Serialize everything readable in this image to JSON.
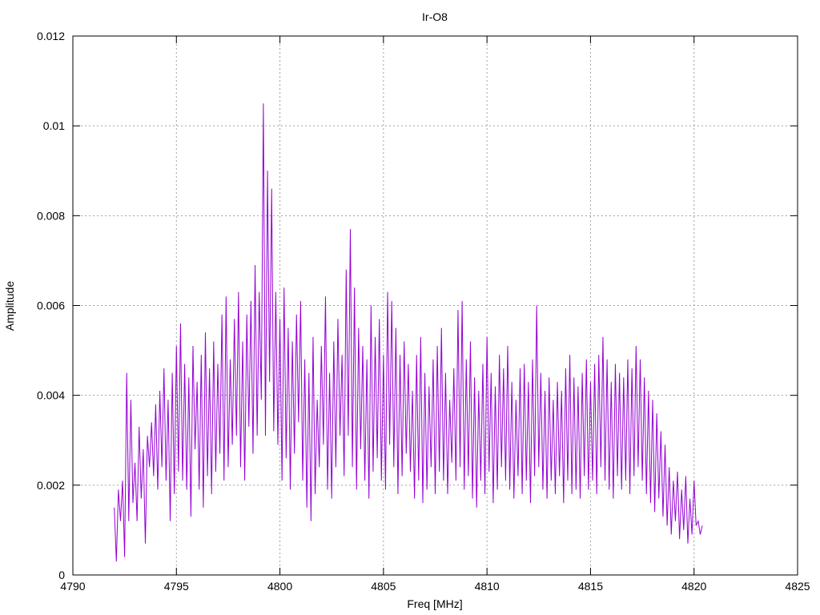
{
  "chart_data": {
    "type": "line",
    "title": "Ir-O8",
    "xlabel": "Freq [MHz]",
    "ylabel": "Amplitude",
    "xlim": [
      4790,
      4825
    ],
    "ylim": [
      0,
      0.012
    ],
    "x_ticks": [
      "4790",
      "4795",
      "4800",
      "4805",
      "4810",
      "4815",
      "4820",
      "4825"
    ],
    "y_ticks": [
      "0",
      "0.002",
      "0.004",
      "0.006",
      "0.008",
      "0.01",
      "0.012"
    ],
    "grid": true,
    "series_color": "#9400d3",
    "series": [
      {
        "x_start": 4792.0,
        "x_step": 0.1,
        "values": [
          0.0015,
          0.0003,
          0.0019,
          0.0012,
          0.0021,
          0.0004,
          0.0045,
          0.0012,
          0.0039,
          0.0016,
          0.0025,
          0.0012,
          0.0033,
          0.0017,
          0.0028,
          0.0007,
          0.0031,
          0.0024,
          0.0034,
          0.0022,
          0.0038,
          0.0019,
          0.0041,
          0.0024,
          0.0046,
          0.0021,
          0.0039,
          0.0012,
          0.0045,
          0.0018,
          0.0051,
          0.0023,
          0.0056,
          0.0021,
          0.0047,
          0.0019,
          0.0044,
          0.0013,
          0.0051,
          0.0028,
          0.0043,
          0.0019,
          0.0049,
          0.0015,
          0.0054,
          0.0022,
          0.0046,
          0.0018,
          0.0052,
          0.0023,
          0.0047,
          0.0027,
          0.0058,
          0.0021,
          0.0062,
          0.0024,
          0.0048,
          0.0029,
          0.0057,
          0.0031,
          0.0063,
          0.0024,
          0.0052,
          0.0021,
          0.0058,
          0.0033,
          0.0061,
          0.0027,
          0.0069,
          0.0031,
          0.0063,
          0.0039,
          0.0105,
          0.0031,
          0.009,
          0.0043,
          0.0086,
          0.0032,
          0.0063,
          0.0029,
          0.0057,
          0.0021,
          0.0064,
          0.0026,
          0.0055,
          0.0019,
          0.0052,
          0.0027,
          0.0058,
          0.0034,
          0.0061,
          0.0021,
          0.0048,
          0.0015,
          0.0045,
          0.0012,
          0.0053,
          0.0018,
          0.0039,
          0.0024,
          0.0051,
          0.0029,
          0.0062,
          0.0019,
          0.0045,
          0.0017,
          0.0052,
          0.0024,
          0.0057,
          0.0031,
          0.0049,
          0.0022,
          0.0068,
          0.0031,
          0.0077,
          0.0024,
          0.0064,
          0.0019,
          0.0055,
          0.0028,
          0.0051,
          0.0021,
          0.0048,
          0.0017,
          0.006,
          0.0023,
          0.0053,
          0.0026,
          0.0057,
          0.0021,
          0.0049,
          0.0019,
          0.0063,
          0.0029,
          0.0061,
          0.0024,
          0.0055,
          0.0018,
          0.0049,
          0.0022,
          0.0052,
          0.0027,
          0.0047,
          0.0023,
          0.0041,
          0.0017,
          0.0049,
          0.0021,
          0.0053,
          0.0016,
          0.0045,
          0.0019,
          0.0042,
          0.0024,
          0.0048,
          0.0018,
          0.0051,
          0.0023,
          0.0055,
          0.0021,
          0.0045,
          0.0018,
          0.0039,
          0.0025,
          0.0046,
          0.0021,
          0.0059,
          0.0024,
          0.0061,
          0.0019,
          0.0048,
          0.0022,
          0.0052,
          0.0017,
          0.0044,
          0.0015,
          0.0041,
          0.0021,
          0.0047,
          0.0018,
          0.0053,
          0.0023,
          0.0045,
          0.0016,
          0.0042,
          0.0019,
          0.0049,
          0.0024,
          0.0046,
          0.0021,
          0.0051,
          0.0019,
          0.0043,
          0.0017,
          0.0039,
          0.0022,
          0.0046,
          0.0018,
          0.0047,
          0.0021,
          0.0043,
          0.0016,
          0.0048,
          0.0022,
          0.006,
          0.0024,
          0.0045,
          0.0019,
          0.0041,
          0.0017,
          0.0044,
          0.0021,
          0.0039,
          0.0018,
          0.0043,
          0.0022,
          0.0041,
          0.0016,
          0.0046,
          0.0021,
          0.0049,
          0.0018,
          0.0044,
          0.0019,
          0.0042,
          0.0017,
          0.0045,
          0.0022,
          0.0048,
          0.0019,
          0.0043,
          0.0021,
          0.0047,
          0.0018,
          0.0049,
          0.0024,
          0.0053,
          0.0021,
          0.0048,
          0.0019,
          0.0043,
          0.0017,
          0.0047,
          0.0022,
          0.0045,
          0.0019,
          0.0044,
          0.0021,
          0.0048,
          0.0018,
          0.0046,
          0.0022,
          0.0051,
          0.0024,
          0.0048,
          0.0021,
          0.0044,
          0.0018,
          0.0041,
          0.0016,
          0.0039,
          0.0014,
          0.0036,
          0.0017,
          0.0032,
          0.0013,
          0.0029,
          0.0011,
          0.0024,
          0.0009,
          0.0021,
          0.0012,
          0.0023,
          0.0008,
          0.0019,
          0.001,
          0.0022,
          0.0007,
          0.0017,
          0.0009,
          0.0021,
          0.0011,
          0.0012,
          0.0009,
          0.0011
        ],
        "line_width": 1
      }
    ]
  }
}
